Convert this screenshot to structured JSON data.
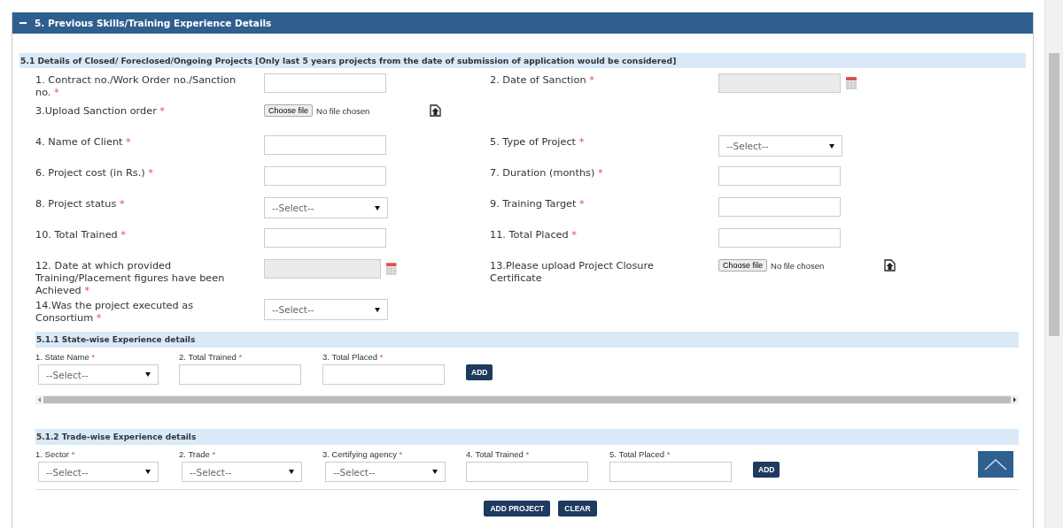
{
  "panel": {
    "title": "5. Previous Skills/Training Experience Details",
    "expanded": true
  },
  "section": {
    "title": "5.1 Details of Closed/ Foreclosed/Ongoing Projects [Only last 5 years projects from the date of submission of application would be considered]",
    "rows": [
      [
        {
          "label": "1. Contract no./Work Order no./Sanction no.",
          "mark": "*",
          "kind": "text"
        },
        {
          "label": "2. Date of Sanction",
          "mark": "*",
          "kind": "date"
        }
      ],
      [
        {
          "label": "3.Upload Sanction order",
          "mark": "*",
          "kind": "file",
          "button": "Choose file",
          "status": "No file chosen"
        }
      ],
      [
        {
          "label": "4. Name of Client",
          "mark": "*",
          "kind": "text"
        },
        {
          "label": "5. Type of Project",
          "mark": "*",
          "kind": "select",
          "value": "--Select--"
        }
      ],
      [
        {
          "label": "6. Project cost (in Rs.)",
          "mark": "*",
          "kind": "text"
        },
        {
          "label": "7. Duration (months)",
          "mark": "*",
          "kind": "text"
        }
      ],
      [
        {
          "label": "8. Project status",
          "mark": "*",
          "kind": "select",
          "value": "--Select--"
        },
        {
          "label": "9. Training Target",
          "mark": "*",
          "kind": "text"
        }
      ],
      [
        {
          "label": "10. Total Trained",
          "mark": "*",
          "kind": "text"
        },
        {
          "label": "11. Total Placed",
          "mark": "*",
          "kind": "text"
        }
      ],
      [
        {
          "label": "12. Date at which provided Training/Placement figures have been Achieved",
          "mark": "*",
          "kind": "date"
        },
        {
          "label": "13.Please upload Project Closure Certificate",
          "kind": "file",
          "button": "Choose file",
          "status": "No file chosen"
        }
      ],
      [
        {
          "label": "14.Was the project executed as Consortium",
          "mark": "*",
          "kind": "select",
          "value": "--Select--"
        }
      ]
    ]
  },
  "subsections": [
    {
      "title": "5.1.1 State-wise Experience details",
      "add_button": "ADD",
      "fields": [
        {
          "label": "1. State Name",
          "mark": "*",
          "kind": "select",
          "value": "--Select--"
        },
        {
          "label": "2. Total Trained",
          "mark": "*",
          "kind": "text"
        },
        {
          "label": "3. Total Placed",
          "mark": "*",
          "kind": "text"
        }
      ]
    },
    {
      "title": "5.1.2 Trade-wise Experience details",
      "add_button": "ADD",
      "fields": [
        {
          "label": "1. Sector",
          "mark": "*",
          "kind": "select",
          "value": "--Select--"
        },
        {
          "label": "2. Trade",
          "mark": "*",
          "kind": "select",
          "value": "--Select--"
        },
        {
          "label": "3. Certifying agency",
          "mark": "*",
          "kind": "select",
          "value": "--Select--"
        },
        {
          "label": "4. Total Trained",
          "mark": "*",
          "kind": "text"
        },
        {
          "label": "5. Total Placed",
          "mark": "*",
          "kind": "text"
        }
      ]
    }
  ],
  "actions": [
    "ADD PROJECT",
    "CLEAR"
  ]
}
